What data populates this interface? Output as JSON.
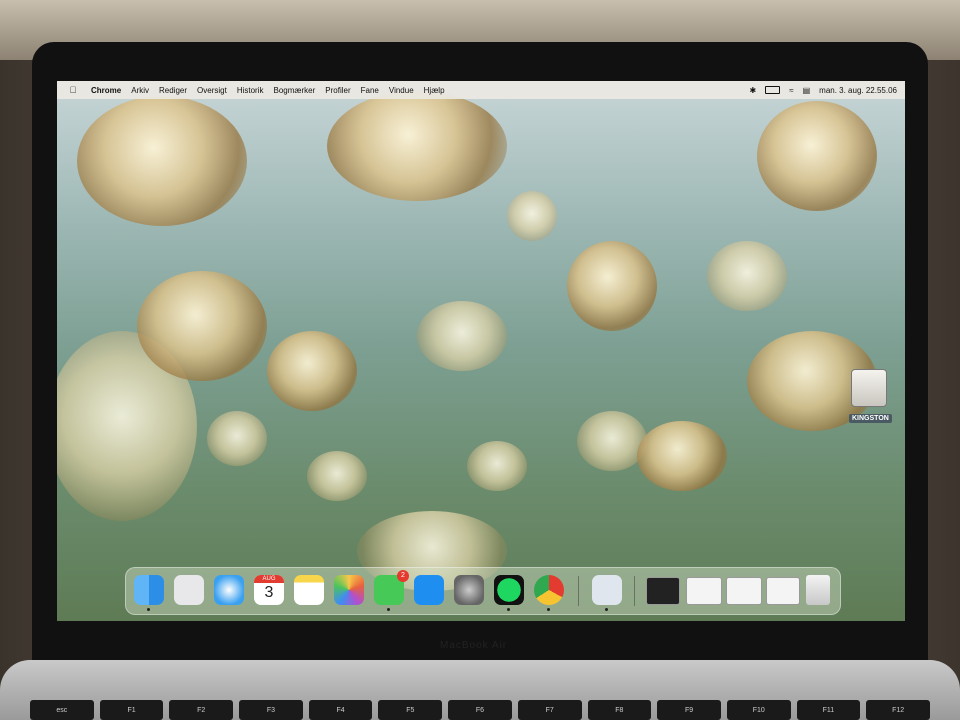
{
  "menubar": {
    "app": "Chrome",
    "items": [
      "Arkiv",
      "Rediger",
      "Oversigt",
      "Historik",
      "Bogmærker",
      "Profiler",
      "Fane",
      "Vindue",
      "Hjælp"
    ],
    "datetime": "man. 3. aug. 22.55.06"
  },
  "drive": {
    "label": "KINGSTON"
  },
  "dock": {
    "calendar": {
      "month": "AUG",
      "day": "3"
    },
    "messages_badge": "2",
    "apps": [
      "finder",
      "launchpad",
      "safari",
      "calendar",
      "notes",
      "photos",
      "messages",
      "app-store",
      "system-preferences",
      "spotify",
      "chrome",
      "preview"
    ]
  },
  "laptop": {
    "model": "MacBook Air"
  },
  "keyboard": [
    "esc",
    "F1",
    "F2",
    "F3",
    "F4",
    "F5",
    "F6",
    "F7",
    "F8",
    "F9",
    "F10",
    "F11",
    "F12"
  ]
}
